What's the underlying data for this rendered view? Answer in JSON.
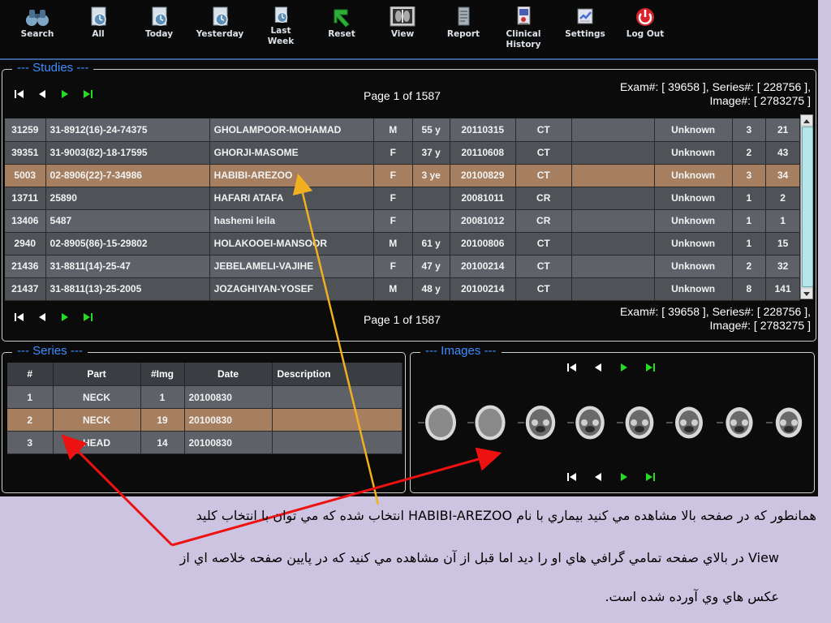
{
  "toolbar": {
    "buttons": [
      {
        "label": "Search",
        "icon": "binoculars-icon"
      },
      {
        "label": "All",
        "icon": "clock-document-icon"
      },
      {
        "label": "Today",
        "icon": "clock-document-icon"
      },
      {
        "label": "Yesterday",
        "icon": "clock-document-icon"
      },
      {
        "label": "Last Week",
        "icon": "clock-document-icon"
      },
      {
        "label": "Reset",
        "icon": "green-arrow-icon"
      },
      {
        "label": "View",
        "icon": "xray-icon"
      },
      {
        "label": "Report",
        "icon": "report-icon"
      },
      {
        "label": "Clinical History",
        "icon": "clinical-history-icon"
      },
      {
        "label": "Settings",
        "icon": "settings-icon"
      },
      {
        "label": "Log Out",
        "icon": "power-icon"
      }
    ]
  },
  "studies": {
    "title": "--- Studies ---",
    "page_label": "Page 1 of 1587",
    "exam_line1": "Exam#: [ 39658 ], Series#: [ 228756 ],",
    "exam_line2": "Image#: [ 2783275 ]",
    "selected_row_index": 2,
    "rows": [
      [
        "31259",
        "31-8912(16)-24-74375",
        "GHOLAMPOOR-MOHAMAD",
        "M",
        "55 y",
        "20110315",
        "CT",
        "",
        "Unknown",
        "3",
        "21"
      ],
      [
        "39351",
        "31-9003(82)-18-17595",
        "GHORJI-MASOME",
        "F",
        "37 y",
        "20110608",
        "CT",
        "",
        "Unknown",
        "2",
        "43"
      ],
      [
        "5003",
        "02-8906(22)-7-34986",
        "HABIBI-AREZOO",
        "F",
        "3 ye",
        "20100829",
        "CT",
        "",
        "Unknown",
        "3",
        "34"
      ],
      [
        "13711",
        "25890",
        "HAFARI ATAFA",
        "F",
        "",
        "20081011",
        "CR",
        "",
        "Unknown",
        "1",
        "2"
      ],
      [
        "13406",
        "5487",
        "hashemi leila",
        "F",
        "",
        "20081012",
        "CR",
        "",
        "Unknown",
        "1",
        "1"
      ],
      [
        "2940",
        "02-8905(86)-15-29802",
        "HOLAKOOEI-MANSOOR",
        "M",
        "61 y",
        "20100806",
        "CT",
        "",
        "Unknown",
        "1",
        "15"
      ],
      [
        "21436",
        "31-8811(14)-25-47",
        "JEBELAMELI-VAJIHE",
        "F",
        "47 y",
        "20100214",
        "CT",
        "",
        "Unknown",
        "2",
        "32"
      ],
      [
        "21437",
        "31-8811(13)-25-2005",
        "JOZAGHIYAN-YOSEF",
        "M",
        "48 y",
        "20100214",
        "CT",
        "",
        "Unknown",
        "8",
        "141"
      ]
    ]
  },
  "series": {
    "title": "--- Series ---",
    "headers": [
      "#",
      "Part",
      "#Img",
      "Date",
      "Description"
    ],
    "selected_row_index": 1,
    "rows": [
      [
        "1",
        "NECK",
        "1",
        "20100830",
        ""
      ],
      [
        "2",
        "NECK",
        "19",
        "20100830",
        ""
      ],
      [
        "3",
        "HEAD",
        "14",
        "20100830",
        ""
      ]
    ]
  },
  "images": {
    "title": "--- Images ---",
    "thumbnail_count": 8
  },
  "caption": {
    "line1": "همانطور که در صفحه بالا مشاهده مي کنيد بيماري  با نام HABIBI-AREZOO انتخاب شده که مي توان با انتخاب کليد",
    "line2": "View در بالاي صفحه تمامي گرافي هاي او را ديد اما قبل از آن مشاهده مي کنيد که در پايين صفحه خلاصه اي از",
    "line3": "عکس هاي وي آورده شده است."
  },
  "colors": {
    "panel_title": "#3f8cff",
    "row_selected": "#a57f5f",
    "nav_green": "#22dd22",
    "arrow_red": "#ee1111",
    "arrow_yellow": "#f0b020"
  }
}
